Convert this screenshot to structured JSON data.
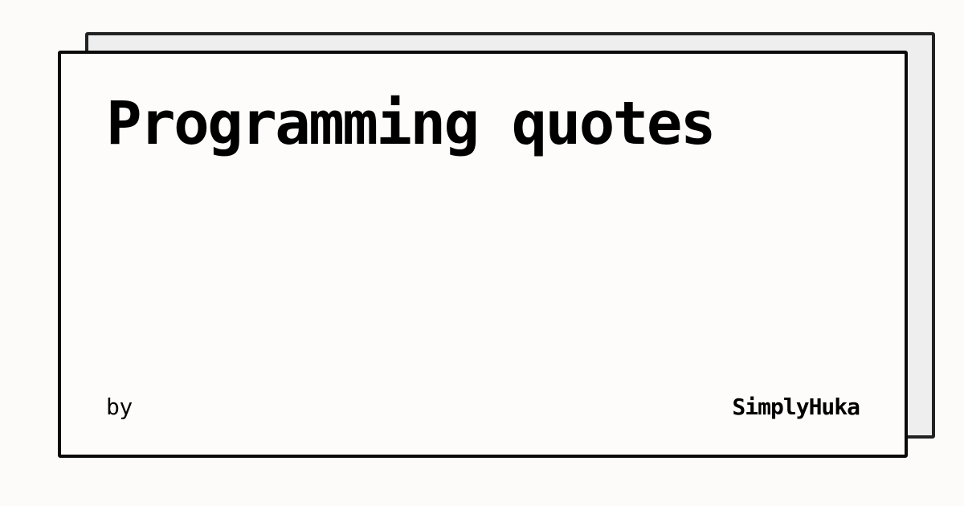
{
  "card": {
    "title": "Programming quotes",
    "by_label": "by",
    "author": "SimplyHuka"
  },
  "colors": {
    "page_background": "#fcfbf9",
    "card_background": "#fdfcfa",
    "back_card_background": "#eeeeee",
    "border": "#0a0a0a",
    "text": "#000000"
  }
}
